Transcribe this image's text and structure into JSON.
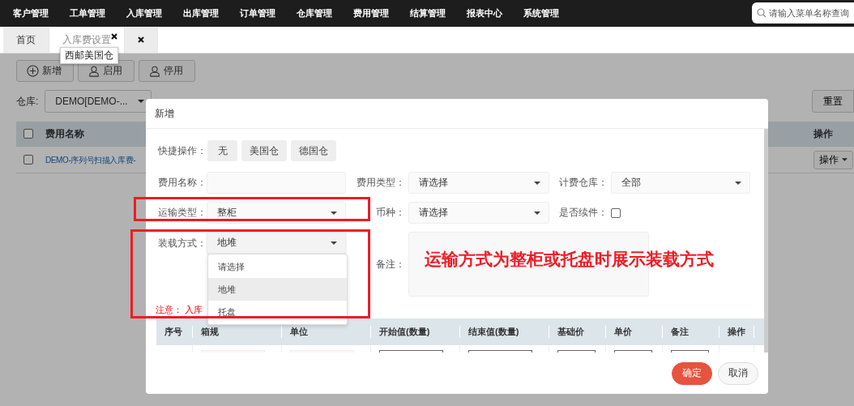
{
  "top_nav": {
    "menus": [
      "客户管理",
      "工单管理",
      "入库管理",
      "出库管理",
      "订单管理",
      "仓库管理",
      "费用管理",
      "结算管理",
      "报表中心",
      "系统管理"
    ],
    "search": {
      "placeholder": "请输入菜单名称查询"
    }
  },
  "tabs": [
    {
      "label": "首页",
      "selected": false,
      "closable": false
    },
    {
      "label": "入库费设置",
      "selected": true,
      "closable": true
    },
    {
      "selected": false,
      "closable": true
    }
  ],
  "tooltip": "西邮美国仓",
  "toolbar": [
    {
      "label": "新增"
    },
    {
      "label": "启用"
    },
    {
      "label": "停用"
    }
  ],
  "filter": {
    "label": "仓库:",
    "value": "DEMO[DEMO-..."
  },
  "reset_button": "重置",
  "table": {
    "columns": [
      "费用名称",
      "操作"
    ],
    "header_checked": false,
    "rows": [
      {
        "name": "DEMO-序列号扫描入库费-",
        "action": "操作",
        "checked": false
      }
    ]
  },
  "dialog": {
    "title": "新增",
    "quick": {
      "label": "快捷操作：",
      "buttons": [
        "无",
        "美国仓",
        "德国仓"
      ]
    },
    "fields": [
      {
        "kind": "input",
        "label": "费用名称："
      },
      {
        "kind": "select",
        "label": "费用类型：",
        "value": "请选择"
      },
      {
        "kind": "select",
        "label": "计费仓库：",
        "value": "全部"
      },
      {
        "kind": "select",
        "label": "运输类型：",
        "value": "整柜"
      },
      {
        "kind": "select",
        "label": "币种：",
        "value": "请选择"
      },
      {
        "kind": "checkbox",
        "label": "是否续件：",
        "checked": false
      },
      {
        "kind": "select",
        "label": "装载方式：",
        "value": "地堆",
        "expanded": true
      },
      {
        "kind": "textarea",
        "label": "备注："
      }
    ],
    "options": [
      {
        "label": "请选择",
        "selected": false
      },
      {
        "label": "地堆",
        "selected": true
      },
      {
        "label": "托盘",
        "selected": false
      }
    ],
    "notice": {
      "label": "注意：",
      "text": "入库"
    },
    "columns": [
      "序号",
      "箱规",
      "单位",
      "开始值(数量)",
      "结束值(数量)",
      "基础价",
      "单价",
      "备注",
      "操作"
    ],
    "buttons": [
      {
        "label": "确定",
        "kind": "primary"
      },
      {
        "label": "取消",
        "kind": "default"
      }
    ]
  },
  "annotation": "运输方式为整柜或托盘时展示装载方式"
}
